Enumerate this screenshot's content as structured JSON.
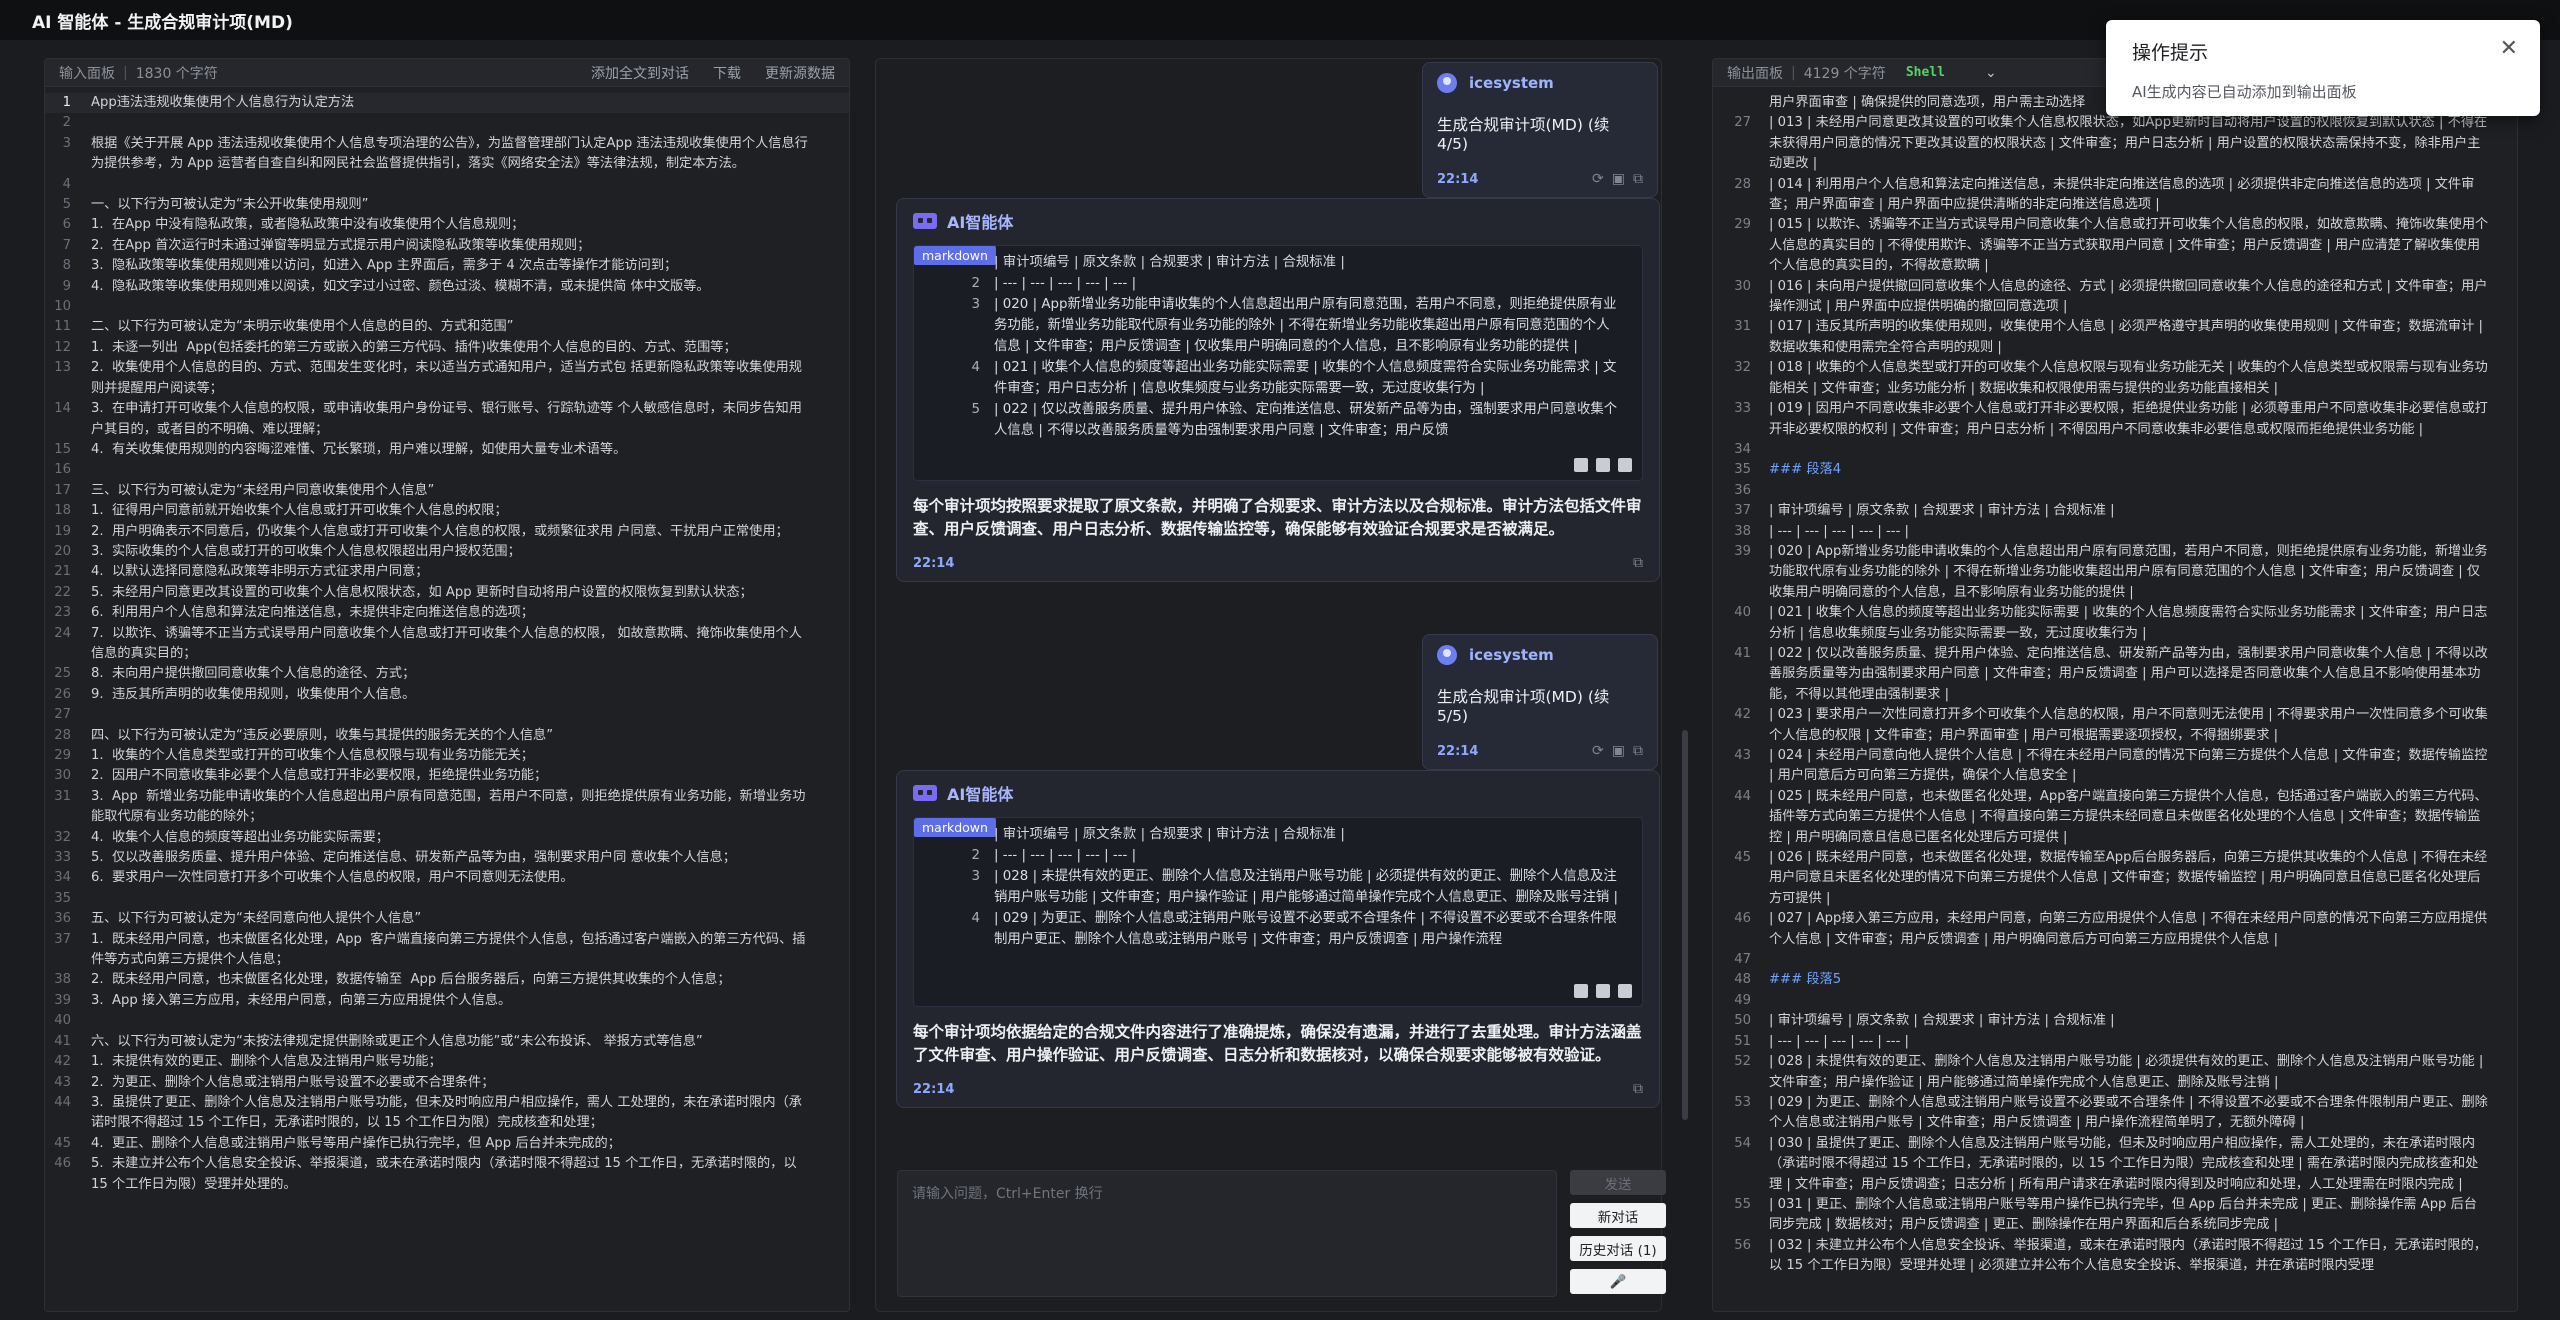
{
  "app": {
    "title": "AI 智能体 - 生成合规审计项(MD)"
  },
  "input_panel": {
    "title": "输入面板",
    "char_count": "1830 个字符",
    "actions": [
      "添加全文到对话",
      "下载",
      "更新源数据"
    ],
    "lines": [
      "App违法违规收集使用个人信息行为认定方法",
      "",
      "根据《关于开展 App 违法违规收集使用个人信息专项治理的公告》，为监督管理部门认定App 违法违规收集使用个人信息行为提供参考，为 App 运营者自查自纠和网民社会监督提供指引，落实《网络安全法》等法律法规，制定本方法。",
      "",
      "一、以下行为可被认定为“未公开收集使用规则”",
      "1.  在App 中没有隐私政策，或者隐私政策中没有收集使用个人信息规则；",
      "2.  在App 首次运行时未通过弹窗等明显方式提示用户阅读隐私政策等收集使用规则；",
      "3.  隐私政策等收集使用规则难以访问，如进入 App 主界面后，需多于 4 次点击等操作才能访问到；",
      "4.  隐私政策等收集使用规则难以阅读，如文字过小过密、颜色过淡、模糊不清，或未提供简 体中文版等。",
      "",
      "二、以下行为可被认定为“未明示收集使用个人信息的目的、方式和范围”",
      "1.  未逐一列出  App(包括委托的第三方或嵌入的第三方代码、插件)收集使用个人信息的目的、方式、范围等；",
      "2.  收集使用个人信息的目的、方式、范围发生变化时，未以适当方式通知用户，适当方式包 括更新隐私政策等收集使用规则并提醒用户阅读等；",
      "3.  在申请打开可收集个人信息的权限，或申请收集用户身份证号、银行账号、行踪轨迹等 个人敏感信息时，未同步告知用户其目的，或者目的不明确、难以理解；",
      "4.  有关收集使用规则的内容晦涩难懂、冗长繁琐，用户难以理解，如使用大量专业术语等。",
      "",
      "三、以下行为可被认定为“未经用户同意收集使用个人信息”",
      "1.  征得用户同意前就开始收集个人信息或打开可收集个人信息的权限；",
      "2.  用户明确表示不同意后，仍收集个人信息或打开可收集个人信息的权限，或频繁征求用 户同意、干扰用户正常使用；",
      "3.  实际收集的个人信息或打开的可收集个人信息权限超出用户授权范围；",
      "4.  以默认选择同意隐私政策等非明示方式征求用户同意；",
      "5.  未经用户同意更改其设置的可收集个人信息权限状态，如 App 更新时自动将用户设置的权限恢复到默认状态；",
      "6.  利用用户个人信息和算法定向推送信息，未提供非定向推送信息的选项；",
      "7.  以欺诈、诱骗等不正当方式误导用户同意收集个人信息或打开可收集个人信息的权限， 如故意欺瞒、掩饰收集使用个人信息的真实目的；",
      "8.  未向用户提供撤回同意收集个人信息的途径、方式；",
      "9.  违反其所声明的收集使用规则，收集使用个人信息。",
      "",
      "四、以下行为可被认定为“违反必要原则，收集与其提供的服务无关的个人信息”",
      "1.  收集的个人信息类型或打开的可收集个人信息权限与现有业务功能无关；",
      "2.  因用户不同意收集非必要个人信息或打开非必要权限，拒绝提供业务功能；",
      "3.  App  新增业务功能申请收集的个人信息超出用户原有同意范围，若用户不同意，则拒绝提供原有业务功能，新增业务功能取代原有业务功能的除外；",
      "4.  收集个人信息的频度等超出业务功能实际需要；",
      "5.  仅以改善服务质量、提升用户体验、定向推送信息、研发新产品等为由，强制要求用户同 意收集个人信息；",
      "6.  要求用户一次性同意打开多个可收集个人信息的权限，用户不同意则无法使用。",
      "",
      "五、以下行为可被认定为“未经同意向他人提供个人信息”",
      "1.  既未经用户同意，也未做匿名化处理，App  客户端直接向第三方提供个人信息，包括通过客户端嵌入的第三方代码、插件等方式向第三方提供个人信息；",
      "2.  既未经用户同意，也未做匿名化处理，数据传输至  App 后台服务器后，向第三方提供其收集的个人信息；",
      "3.  App 接入第三方应用，未经用户同意，向第三方应用提供个人信息。",
      "",
      "六、以下行为可被认定为“未按法律规定提供删除或更正个人信息功能”或“未公布投诉、 举报方式等信息”",
      "1.  未提供有效的更正、删除个人信息及注销用户账号功能；",
      "2.  为更正、删除个人信息或注销用户账号设置不必要或不合理条件；",
      "3.  虽提供了更正、删除个人信息及注销用户账号功能，但未及时响应用户相应操作，需人 工处理的，未在承诺时限内（承诺时限不得超过 15 个工作日，无承诺时限的，以 15 个工作日为限）完成核查和处理；",
      "4.  更正、删除个人信息或注销用户账号等用户操作已执行完毕，但 App 后台并未完成的；",
      "5.  未建立并公布个人信息安全投诉、举报渠道，或未在承诺时限内（承诺时限不得超过 15 个工作日，无承诺时限的，以 15 个工作日为限）受理并处理的。"
    ]
  },
  "chat": {
    "messages": [
      {
        "type": "user",
        "author": "icesystem",
        "text": "生成合规审计项(MD) (续 4/5)",
        "time": "22:14"
      },
      {
        "type": "ai",
        "author": "AI智能体",
        "code_tag": "markdown",
        "code_header": "| 审计项编号 | 原文条款 | 合规要求 | 审计方法 | 合规标准 |",
        "code_lines": [
          {
            "n": "2",
            "t": "| --- | --- | --- | --- | --- |"
          },
          {
            "n": "3",
            "t": "| 020 | App新增业务功能申请收集的个人信息超出用户原有同意范围，若用户不同意，则拒绝提供原有业务功能，新增业务功能取代原有业务功能的除外 | 不得在新增业务功能收集超出用户原有同意范围的个人信息 | 文件审查；用户反馈调查 | 仅收集用户明确同意的个人信息，且不影响原有业务功能的提供 |"
          },
          {
            "n": "4",
            "t": "| 021 | 收集个人信息的频度等超出业务功能实际需要 | 收集的个人信息频度需符合实际业务功能需求 | 文件审查；用户日志分析 | 信息收集频度与业务功能实际需要一致，无过度收集行为 |"
          },
          {
            "n": "5",
            "t": "| 022 | 仅以改善服务质量、提升用户体验、定向推送信息、研发新产品等为由，强制要求用户同意收集个人信息 | 不得以改善服务质量等为由强制要求用户同意 | 文件审查；用户反馈"
          }
        ],
        "summary": "每个审计项均按照要求提取了原文条款，并明确了合规要求、审计方法以及合规标准。审计方法包括文件审查、用户反馈调查、用户日志分析、数据传输监控等，确保能够有效验证合规要求是否被满足。",
        "time": "22:14"
      },
      {
        "type": "user",
        "author": "icesystem",
        "text": "生成合规审计项(MD) (续 5/5)",
        "time": "22:14"
      },
      {
        "type": "ai",
        "author": "AI智能体",
        "code_tag": "markdown",
        "code_header": "| 审计项编号 | 原文条款 | 合规要求 | 审计方法 | 合规标准 |",
        "code_lines": [
          {
            "n": "2",
            "t": "| --- | --- | --- | --- | --- |"
          },
          {
            "n": "3",
            "t": "| 028 | 未提供有效的更正、删除个人信息及注销用户账号功能 | 必须提供有效的更正、删除个人信息及注销用户账号功能 | 文件审查；用户操作验证 | 用户能够通过简单操作完成个人信息更正、删除及账号注销 |"
          },
          {
            "n": "4",
            "t": "| 029 | 为更正、删除个人信息或注销用户账号设置不必要或不合理条件 | 不得设置不必要或不合理条件限制用户更正、删除个人信息或注销用户账号 | 文件审查；用户反馈调查 | 用户操作流程"
          }
        ],
        "summary": "每个审计项均依据给定的合规文件内容进行了准确提炼，确保没有遗漏，并进行了去重处理。审计方法涵盖了文件审查、用户操作验证、用户反馈调查、日志分析和数据核对，以确保合规要求能够被有效验证。",
        "time": "22:14"
      }
    ],
    "input_placeholder": "请输入问题，Ctrl+Enter 换行",
    "buttons": {
      "send": "发送",
      "new_chat": "新对话",
      "history": "历史对话 (1)"
    }
  },
  "output_panel": {
    "title": "输出面板",
    "char_count": "4129 个字符",
    "lang": "Shell",
    "lines": [
      {
        "n": "",
        "t": "用户界面审查 | 确保提供的同意选项，用户需主动选择"
      },
      {
        "n": "27",
        "t": "| 013 | 未经用户同意更改其设置的可收集个人信息权限状态，如App更新时自动将用户设置的权限恢复到默认状态 | 不得在未获得用户同意的情况下更改其设置的权限状态 | 文件审查；用户日志分析 | 用户设置的权限状态需保持不变，除非用户主动更改 |"
      },
      {
        "n": "28",
        "t": "| 014 | 利用用户个人信息和算法定向推送信息，未提供非定向推送信息的选项 | 必须提供非定向推送信息的选项 | 文件审查；用户界面审查 | 用户界面中应提供清晰的非定向推送信息选项 |"
      },
      {
        "n": "29",
        "t": "| 015 | 以欺诈、诱骗等不正当方式误导用户同意收集个人信息或打开可收集个人信息的权限，如故意欺瞒、掩饰收集使用个人信息的真实目的 | 不得使用欺诈、诱骗等不正当方式获取用户同意 | 文件审查；用户反馈调查 | 用户应清楚了解收集使用个人信息的真实目的，不得故意欺瞒 |"
      },
      {
        "n": "30",
        "t": "| 016 | 未向用户提供撤回同意收集个人信息的途径、方式 | 必须提供撤回同意收集个人信息的途径和方式 | 文件审查；用户操作测试 | 用户界面中应提供明确的撤回同意选项 |"
      },
      {
        "n": "31",
        "t": "| 017 | 违反其所声明的收集使用规则，收集使用个人信息 | 必须严格遵守其声明的收集使用规则 | 文件审查；数据流审计 | 数据收集和使用需完全符合声明的规则 |"
      },
      {
        "n": "32",
        "t": "| 018 | 收集的个人信息类型或打开的可收集个人信息权限与现有业务功能无关 | 收集的个人信息类型或权限需与现有业务功能相关 | 文件审查；业务功能分析 | 数据收集和权限使用需与提供的业务功能直接相关 |"
      },
      {
        "n": "33",
        "t": "| 019 | 因用户不同意收集非必要个人信息或打开非必要权限，拒绝提供业务功能 | 必须尊重用户不同意收集非必要信息或打开非必要权限的权利 | 文件审查；用户日志分析 | 不得因用户不同意收集非必要信息或权限而拒绝提供业务功能 |"
      },
      {
        "n": "34",
        "t": ""
      },
      {
        "n": "35",
        "t": "### 段落4",
        "h": true
      },
      {
        "n": "36",
        "t": ""
      },
      {
        "n": "37",
        "t": "| 审计项编号 | 原文条款 | 合规要求 | 审计方法 | 合规标准 |"
      },
      {
        "n": "38",
        "t": "| --- | --- | --- | --- | --- |"
      },
      {
        "n": "39",
        "t": "| 020 | App新增业务功能申请收集的个人信息超出用户原有同意范围，若用户不同意，则拒绝提供原有业务功能，新增业务功能取代原有业务功能的除外 | 不得在新增业务功能收集超出用户原有同意范围的个人信息 | 文件审查；用户反馈调查 | 仅收集用户明确同意的个人信息，且不影响原有业务功能的提供 |"
      },
      {
        "n": "40",
        "t": "| 021 | 收集个人信息的频度等超出业务功能实际需要 | 收集的个人信息频度需符合实际业务功能需求 | 文件审查；用户日志分析 | 信息收集频度与业务功能实际需要一致，无过度收集行为 |"
      },
      {
        "n": "41",
        "t": "| 022 | 仅以改善服务质量、提升用户体验、定向推送信息、研发新产品等为由，强制要求用户同意收集个人信息 | 不得以改善服务质量等为由强制要求用户同意 | 文件审查；用户反馈调查 | 用户可以选择是否同意收集个人信息且不影响使用基本功能，不得以其他理由强制要求 |"
      },
      {
        "n": "42",
        "t": "| 023 | 要求用户一次性同意打开多个可收集个人信息的权限，用户不同意则无法使用 | 不得要求用户一次性同意多个可收集个人信息的权限 | 文件审查；用户界面审查 | 用户可根据需要逐项授权，不得捆绑要求 |"
      },
      {
        "n": "43",
        "t": "| 024 | 未经用户同意向他人提供个人信息 | 不得在未经用户同意的情况下向第三方提供个人信息 | 文件审查；数据传输监控 | 用户同意后方可向第三方提供，确保个人信息安全 |"
      },
      {
        "n": "44",
        "t": "| 025 | 既未经用户同意，也未做匿名化处理，App客户端直接向第三方提供个人信息，包括通过客户端嵌入的第三方代码、插件等方式向第三方提供个人信息 | 不得直接向第三方提供未经同意且未做匿名化处理的个人信息 | 文件审查；数据传输监控 | 用户明确同意且信息已匿名化处理后方可提供 |"
      },
      {
        "n": "45",
        "t": "| 026 | 既未经用户同意，也未做匿名化处理，数据传输至App后台服务器后，向第三方提供其收集的个人信息 | 不得在未经用户同意且未匿名化处理的情况下向第三方提供个人信息 | 文件审查；数据传输监控 | 用户明确同意且信息已匿名化处理后方可提供 |"
      },
      {
        "n": "46",
        "t": "| 027 | App接入第三方应用，未经用户同意，向第三方应用提供个人信息 | 不得在未经用户同意的情况下向第三方应用提供个人信息 | 文件审查；用户反馈调查 | 用户明确同意后方可向第三方应用提供个人信息 |"
      },
      {
        "n": "47",
        "t": ""
      },
      {
        "n": "48",
        "t": "### 段落5",
        "h": true
      },
      {
        "n": "49",
        "t": ""
      },
      {
        "n": "50",
        "t": "| 审计项编号 | 原文条款 | 合规要求 | 审计方法 | 合规标准 |"
      },
      {
        "n": "51",
        "t": "| --- | --- | --- | --- | --- |"
      },
      {
        "n": "52",
        "t": "| 028 | 未提供有效的更正、删除个人信息及注销用户账号功能 | 必须提供有效的更正、删除个人信息及注销用户账号功能 | 文件审查；用户操作验证 | 用户能够通过简单操作完成个人信息更正、删除及账号注销 |"
      },
      {
        "n": "53",
        "t": "| 029 | 为更正、删除个人信息或注销用户账号设置不必要或不合理条件 | 不得设置不必要或不合理条件限制用户更正、删除个人信息或注销用户账号 | 文件审查；用户反馈调查 | 用户操作流程简单明了，无额外障碍 |"
      },
      {
        "n": "54",
        "t": "| 030 | 虽提供了更正、删除个人信息及注销用户账号功能，但未及时响应用户相应操作，需人工处理的，未在承诺时限内（承诺时限不得超过 15 个工作日，无承诺时限的，以 15 个工作日为限）完成核查和处理 | 需在承诺时限内完成核查和处理 | 文件审查；用户反馈调查；日志分析 | 所有用户请求在承诺时限内得到及时响应和处理，人工处理需在时限内完成 |"
      },
      {
        "n": "55",
        "t": "| 031 | 更正、删除个人信息或注销用户账号等用户操作已执行完毕，但 App 后台并未完成 | 更正、删除操作需 App 后台同步完成 | 数据核对；用户反馈调查 | 更正、删除操作在用户界面和后台系统同步完成 |"
      },
      {
        "n": "56",
        "t": "| 032 | 未建立并公布个人信息安全投诉、举报渠道，或未在承诺时限内（承诺时限不得超过 15 个工作日，无承诺时限的，以 15 个工作日为限）受理并处理 | 必须建立并公布个人信息安全投诉、举报渠道，并在承诺时限内受理"
      }
    ]
  },
  "toast": {
    "title": "操作提示",
    "message": "AI生成内容已自动添加到输出面板"
  },
  "colors": {
    "accent": "#5d6ee8",
    "user_name": "#9db4ff",
    "shell": "#56d364"
  }
}
